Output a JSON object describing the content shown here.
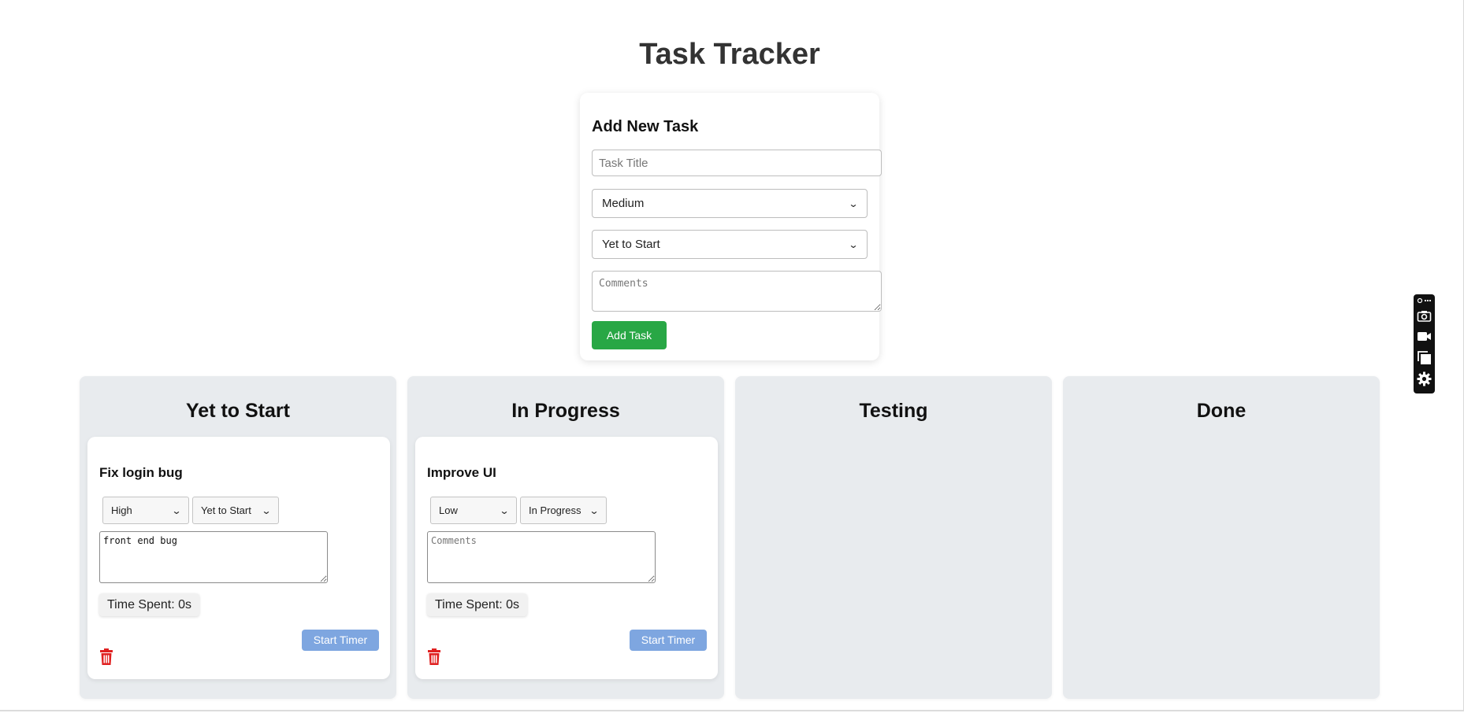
{
  "app": {
    "title": "Task Tracker"
  },
  "form": {
    "heading": "Add New Task",
    "title_placeholder": "Task Title",
    "title_value": "",
    "priority": "Medium",
    "status": "Yet to Start",
    "comments_placeholder": "Comments",
    "submit_label": "Add Task"
  },
  "columns": [
    {
      "title": "Yet to Start",
      "tasks": [
        {
          "title": "Fix login bug",
          "priority": "High",
          "status": "Yet to Start",
          "comments": "front end bug",
          "comments_placeholder": "Comments",
          "time_spent": "Time Spent: 0s",
          "timer_label": "Start Timer"
        }
      ]
    },
    {
      "title": "In Progress",
      "tasks": [
        {
          "title": "Improve UI",
          "priority": "Low",
          "status": "In Progress",
          "comments": "",
          "comments_placeholder": "Comments",
          "time_spent": "Time Spent: 0s",
          "timer_label": "Start Timer"
        }
      ]
    },
    {
      "title": "Testing",
      "tasks": []
    },
    {
      "title": "Done",
      "tasks": []
    }
  ],
  "colors": {
    "add_button": "#28a745",
    "timer_button": "#7ea6e0",
    "delete_icon": "#e02020",
    "column_bg": "#e8ebee"
  },
  "icons": {
    "task_delete": "trash-icon",
    "toolbar": [
      "link-icon",
      "more-icon",
      "camera-icon",
      "video-icon",
      "copy-icon",
      "gear-icon"
    ]
  }
}
